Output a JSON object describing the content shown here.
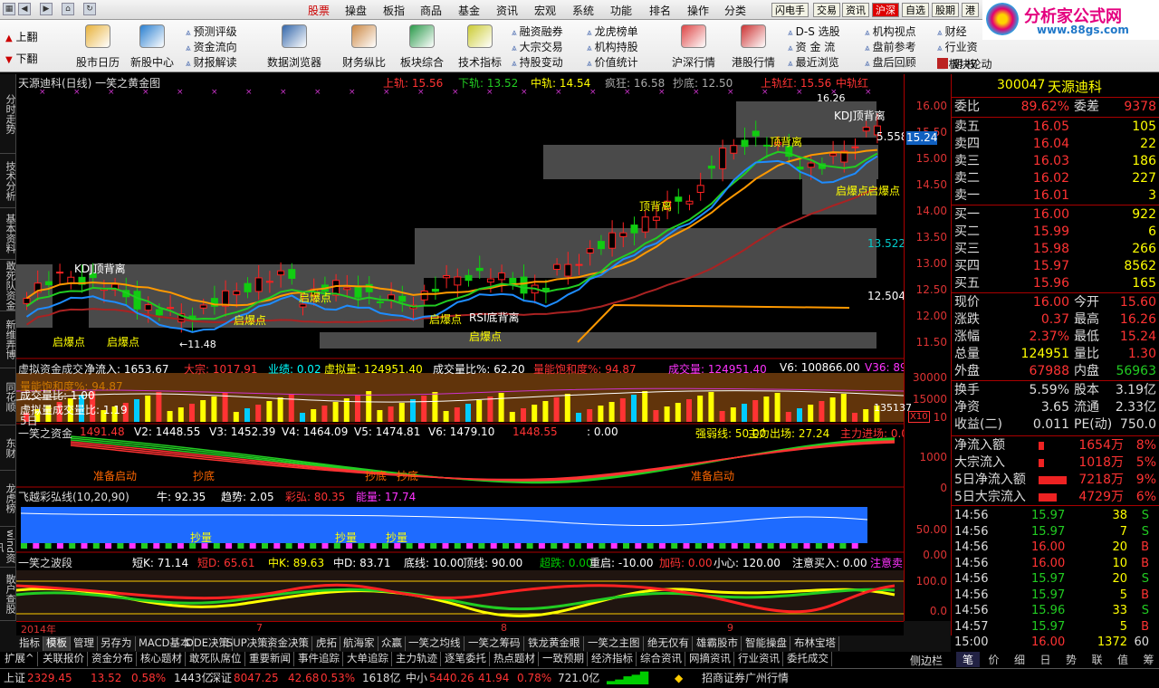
{
  "menubar": {
    "menus": [
      "股票",
      "操盘",
      "板指",
      "商品",
      "基金",
      "资讯",
      "宏观",
      "系统",
      "功能",
      "排名",
      "操作",
      "分类"
    ],
    "quick_tabs": [
      "闪电手",
      "交易",
      "资讯",
      "沪深",
      "自选",
      "股期",
      "港"
    ],
    "logo_text": "分析家公式网",
    "logo_url": "www.88gs.com"
  },
  "toolbar": {
    "page_up": "上翻",
    "page_down": "下翻",
    "big_buttons": [
      "股市日历",
      "新股中心",
      "数据浏览器",
      "财务纵比",
      "板块综合",
      "技术指标",
      "沪深行情",
      "港股行情"
    ],
    "small_col1": [
      "预测评级",
      "资金流向",
      "财报解读"
    ],
    "small_col2": [
      "融资融券",
      "大宗交易",
      "持股变动"
    ],
    "small_col3": [
      "龙虎榜单",
      "机构持股",
      "价值统计"
    ],
    "small_col4": [
      "D-S 选股",
      "资 金 流",
      "最近浏览"
    ],
    "small_col5": [
      "机构视点",
      "盘前参考",
      "盘后回顾"
    ],
    "small_col6": [
      "财经",
      "行业资",
      "板块轮动"
    ],
    "misc": "期 权"
  },
  "left_tabs": [
    "分时走势",
    "技术分析",
    "基本资料",
    "敢死队资金",
    "新维弄博",
    "同花顺",
    "东财",
    "龙虎榜",
    "wind资讯",
    "散户查股",
    "提示"
  ],
  "chart": {
    "title": "天源迪科(日线)  一笑之黄金图",
    "indicators_main": [
      {
        "text": "上轨: 15.56",
        "color": "#f33"
      },
      {
        "text": "下轨: 13.52",
        "color": "#2c2"
      },
      {
        "text": "中轨: 14.54",
        "color": "#ff0"
      },
      {
        "text": "疯狂: 16.58",
        "color": "#aaa"
      },
      {
        "text": "抄底: 12.50",
        "color": "#aaa"
      },
      {
        "text": "上轨红: 15.56",
        "color": "#f33"
      },
      {
        "text": "中轨红",
        "color": "#f33"
      }
    ],
    "price_labels": {
      "high": "16.26",
      "low": "11.48",
      "current": "5.558",
      "cur_price_box": "15.24"
    },
    "price_axis": [
      "16.00",
      "15.50",
      "15.00",
      "14.50",
      "14.00",
      "13.50",
      "13.00",
      "12.50",
      "12.00",
      "11.50"
    ],
    "annotations": [
      "KDJ顶背离",
      "KDJ顶背离",
      "顶背离",
      "顶背离",
      "RSI底背离",
      "启爆点",
      "启爆点",
      "启爆点",
      "启爆点",
      "启爆点",
      "启爆点",
      "启爆点",
      "启爆点",
      "13.522",
      "12.504"
    ],
    "sub1_title": "虚拟资金成交",
    "sub1_items": [
      {
        "text": "净流入: 1653.67",
        "color": "#fff"
      },
      {
        "text": "大宗: 1017.91",
        "color": "#f33"
      },
      {
        "text": "业绩: 0.02",
        "color": "#0ff"
      },
      {
        "text": "虚拟量: 124951.40",
        "color": "#ff0"
      },
      {
        "text": "成交量比%: 62.20",
        "color": "#fff"
      },
      {
        "text": "量能饱和度%: 94.87",
        "color": "#f33"
      },
      {
        "text": "成交量: 124951.40",
        "color": "#f3f"
      },
      {
        "text": "V6: 100866.00",
        "color": "#fff"
      },
      {
        "text": "V36: 89",
        "color": "#f3f"
      }
    ],
    "sub1_axis": [
      "30000",
      "15000",
      "10"
    ],
    "sub1_side": "135137",
    "sub1_side2": "X10",
    "sub1_overlay": [
      "量能饱和度%: 94.87",
      "成交量比: 1.00",
      "虚拟量成交量比: 1.19",
      "5日"
    ],
    "sub2_title": "一笑之资金",
    "sub2_items": [
      {
        "text": "1491.48",
        "color": "#f33"
      },
      {
        "text": "V2: 1448.55",
        "color": "#fff"
      },
      {
        "text": "V3: 1452.39",
        "color": "#fff"
      },
      {
        "text": "V4: 1464.09",
        "color": "#fff"
      },
      {
        "text": "V5: 1474.81",
        "color": "#fff"
      },
      {
        "text": "V6: 1479.10",
        "color": "#fff"
      },
      {
        "text": "1448.55",
        "color": "#f33"
      },
      {
        "text": ": 0.00",
        "color": "#fff"
      },
      {
        "text": "强弱线: 50.00",
        "color": "#ff0"
      },
      {
        "text": "主力出场: 27.24",
        "color": "#ff0"
      },
      {
        "text": "主力进场: 0.00",
        "color": "#f33"
      }
    ],
    "sub2_axis": [
      "1000",
      "0"
    ],
    "sub2_tags": [
      "准备启动",
      "抄底",
      "抄底",
      "抄底",
      "准备启动"
    ],
    "sub3_title": "飞越彩弘线(10,20,90)",
    "sub3_items": [
      {
        "text": "牛: 92.35",
        "color": "#fff"
      },
      {
        "text": "趋势: 2.05",
        "color": "#fff"
      },
      {
        "text": "彩弘: 80.35",
        "color": "#f33"
      },
      {
        "text": "能量: 17.74",
        "color": "#f3f"
      }
    ],
    "sub3_axis": [
      "50.00",
      "0.00"
    ],
    "sub3_tags": [
      "抄量",
      "抄量",
      "抄量"
    ],
    "sub4_title": "一笑之波段",
    "sub4_items": [
      {
        "text": "短K: 71.14",
        "color": "#fff"
      },
      {
        "text": "短D: 65.61",
        "color": "#f33"
      },
      {
        "text": "中K: 89.63",
        "color": "#ff0"
      },
      {
        "text": "中D: 83.71",
        "color": "#fff"
      },
      {
        "text": "底线: 10.00",
        "color": "#fff"
      },
      {
        "text": "顶线: 90.00",
        "color": "#fff"
      },
      {
        "text": "超跌: 0.00",
        "color": "#0c0"
      },
      {
        "text": "重启: -10.00",
        "color": "#fff"
      },
      {
        "text": "加码: 0.00",
        "color": "#f33"
      },
      {
        "text": "小心: 120.00",
        "color": "#fff"
      },
      {
        "text": "注意买入: 0.00",
        "color": "#fff"
      },
      {
        "text": "注意卖",
        "color": "#f3f"
      }
    ],
    "sub4_axis": [
      "100.0",
      "0.0"
    ],
    "date_axis": [
      "2014年",
      "7",
      "8",
      "9"
    ],
    "period": "日线"
  },
  "quote": {
    "code": "300047",
    "name": "天源迪科",
    "weibi_label": "委比",
    "weibi": "89.62%",
    "weicha_label": "委差",
    "weicha": "9378",
    "asks": [
      {
        "label": "卖五",
        "price": "16.05",
        "vol": "105"
      },
      {
        "label": "卖四",
        "price": "16.04",
        "vol": "22"
      },
      {
        "label": "卖三",
        "price": "16.03",
        "vol": "186"
      },
      {
        "label": "卖二",
        "price": "16.02",
        "vol": "227"
      },
      {
        "label": "卖一",
        "price": "16.01",
        "vol": "3"
      }
    ],
    "bids": [
      {
        "label": "买一",
        "price": "16.00",
        "vol": "922"
      },
      {
        "label": "买二",
        "price": "15.99",
        "vol": "6"
      },
      {
        "label": "买三",
        "price": "15.98",
        "vol": "266"
      },
      {
        "label": "买四",
        "price": "15.97",
        "vol": "8562"
      },
      {
        "label": "买五",
        "price": "15.96",
        "vol": "165"
      }
    ],
    "stats": [
      {
        "l1": "现价",
        "v1": "16.00",
        "c1": "#f33",
        "l2": "今开",
        "v2": "15.60",
        "c2": "#f33"
      },
      {
        "l1": "涨跌",
        "v1": "0.37",
        "c1": "#f33",
        "l2": "最高",
        "v2": "16.26",
        "c2": "#f33"
      },
      {
        "l1": "涨幅",
        "v1": "2.37%",
        "c1": "#f33",
        "l2": "最低",
        "v2": "15.24",
        "c2": "#f33"
      },
      {
        "l1": "总量",
        "v1": "124951",
        "c1": "#ff0",
        "l2": "量比",
        "v2": "1.30",
        "c2": "#f33"
      },
      {
        "l1": "外盘",
        "v1": "67988",
        "c1": "#f33",
        "l2": "内盘",
        "v2": "56963",
        "c2": "#2c2"
      }
    ],
    "stats2": [
      {
        "l1": "换手",
        "v1": "5.59%",
        "l2": "股本",
        "v2": "3.19亿"
      },
      {
        "l1": "净资",
        "v1": "3.65",
        "l2": "流通",
        "v2": "2.33亿"
      },
      {
        "l1": "收益(二)",
        "v1": "0.011",
        "l2": "PE(动)",
        "v2": "750.0"
      }
    ],
    "flows": [
      {
        "label": "净流入额",
        "value": "1654万",
        "pct": "8%",
        "fill": 0.08
      },
      {
        "label": "大宗流入",
        "value": "1018万",
        "pct": "5%",
        "fill": 0.05
      },
      {
        "label": "5日净流入额",
        "value": "7218万",
        "pct": "9%",
        "fill": 0.9
      },
      {
        "label": "5日大宗流入",
        "value": "4729万",
        "pct": "6%",
        "fill": 0.6
      }
    ],
    "trades": [
      {
        "time": "14:56",
        "price": "15.97",
        "vol": "38",
        "side": "S"
      },
      {
        "time": "14:56",
        "price": "15.97",
        "vol": "7",
        "side": "S"
      },
      {
        "time": "14:56",
        "price": "16.00",
        "vol": "20",
        "side": "B"
      },
      {
        "time": "14:56",
        "price": "16.00",
        "vol": "10",
        "side": "B"
      },
      {
        "time": "14:56",
        "price": "15.97",
        "vol": "20",
        "side": "S"
      },
      {
        "time": "14:56",
        "price": "15.97",
        "vol": "5",
        "side": "B"
      },
      {
        "time": "14:56",
        "price": "15.96",
        "vol": "33",
        "side": "S"
      },
      {
        "time": "14:57",
        "price": "15.97",
        "vol": "5",
        "side": "B"
      },
      {
        "time": "15:00",
        "price": "16.00",
        "vol": "1372",
        "side": "60"
      }
    ],
    "bottom_tabs": [
      "笔",
      "价",
      "细",
      "日",
      "势",
      "联",
      "值",
      "筹"
    ]
  },
  "bottom": {
    "row1": [
      "指标",
      "模板",
      "管理",
      "另存为",
      "MACD基本",
      "DDE决策",
      "SUP决策",
      "资金决策",
      "虎拓",
      "航海家",
      "众赢",
      "一笑之均线",
      "一笑之筹码",
      "铁龙黄金眼",
      "一笑之主图",
      "绝无仅有",
      "雄霸股市",
      "智能操盘",
      "布林宝塔"
    ],
    "row2": [
      "扩展^",
      "关联报价",
      "资金分布",
      "核心题材",
      "敢死队席位",
      "重要新闻",
      "事件追踪",
      "大单追踪",
      "主力轨迹",
      "逐笔委托",
      "热点题材",
      "一致预期",
      "经济指标",
      "综合资讯",
      "网摘资讯",
      "行业资讯",
      "委托成交"
    ],
    "side": "侧边栏"
  },
  "status": {
    "sh_label": "上证",
    "sh_val": "2329.45",
    "sh_chg": "13.52",
    "sh_pct": "0.58%",
    "sh_amt": "1443亿",
    "sz_label": "深证",
    "sz_val": "8047.25",
    "sz_chg": "42.68",
    "sz_pct": "0.53%",
    "sz_amt": "1618亿",
    "zx_label": "中小",
    "zx_val": "5440.26",
    "zx_chg": "41.94",
    "zx_pct": "0.78%",
    "zx_amt": "721.0亿",
    "broker": "招商证券广州行情"
  }
}
